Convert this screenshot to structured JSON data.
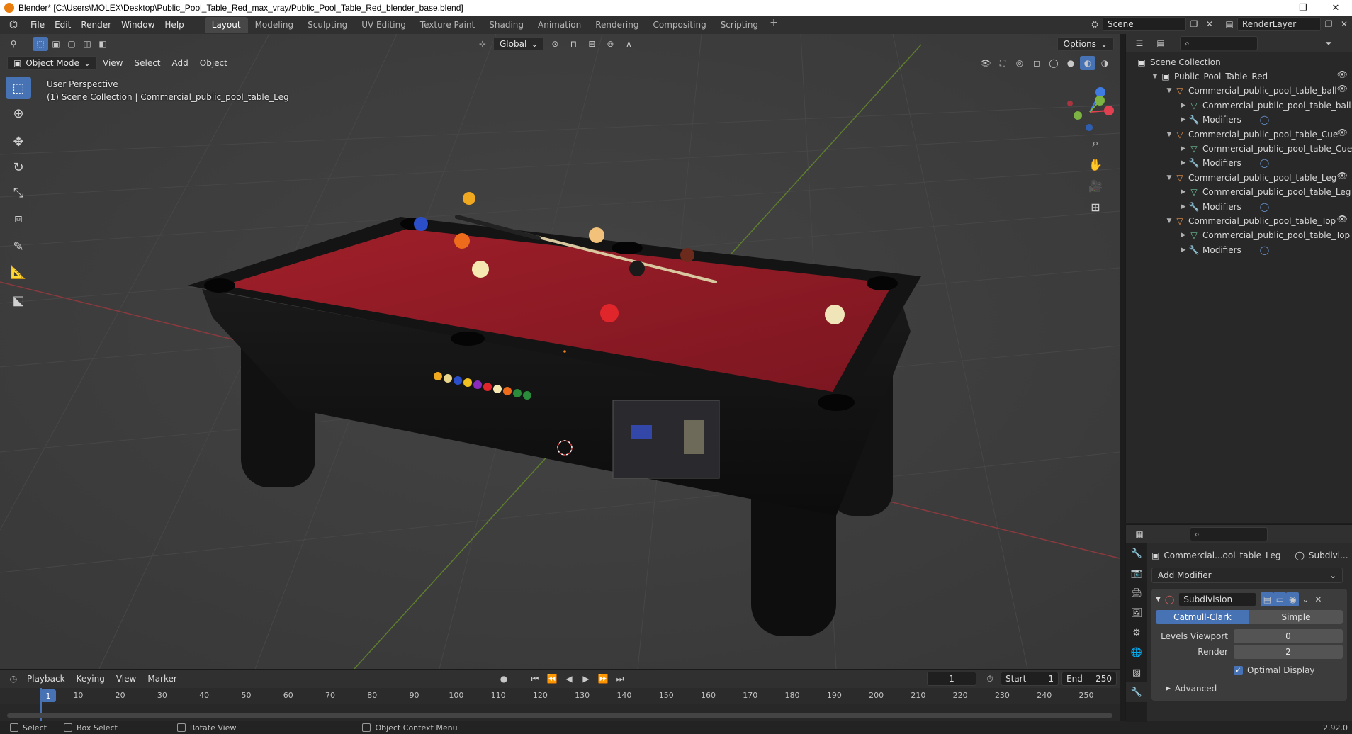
{
  "window": {
    "title": "Blender* [C:\\Users\\MOLEX\\Desktop\\Public_Pool_Table_Red_max_vray/Public_Pool_Table_Red_blender_base.blend]",
    "minimize": "—",
    "maximize": "❐",
    "close": "✕"
  },
  "menu": [
    "File",
    "Edit",
    "Render",
    "Window",
    "Help"
  ],
  "workspaces": [
    "Layout",
    "Modeling",
    "Sculpting",
    "UV Editing",
    "Texture Paint",
    "Shading",
    "Animation",
    "Rendering",
    "Compositing",
    "Scripting"
  ],
  "workspace_add": "+",
  "scene": {
    "name": "Scene",
    "render_layer": "RenderLayer"
  },
  "viewport": {
    "mode": "Object Mode",
    "menus": [
      "View",
      "Select",
      "Add",
      "Object"
    ],
    "transform_orientation": "Global",
    "options_label": "Options",
    "perspective_label": "User Perspective",
    "collection_info": "(1) Scene Collection | Commercial_public_pool_table_Leg",
    "gizmo_axes": {
      "x": "X",
      "y": "Y",
      "z": "Z"
    }
  },
  "tools": [
    "select-box",
    "cursor",
    "move",
    "rotate",
    "scale",
    "transform",
    "annotate",
    "measure",
    "add-cube"
  ],
  "timeline": {
    "menus": [
      "Playback",
      "Keying",
      "View",
      "Marker"
    ],
    "current_frame": "1",
    "start_label": "Start",
    "start": "1",
    "end_label": "End",
    "end": "250",
    "ruler": [
      "10",
      "20",
      "30",
      "40",
      "50",
      "60",
      "70",
      "80",
      "90",
      "100",
      "110",
      "120",
      "130",
      "140",
      "150",
      "160",
      "170",
      "180",
      "190",
      "200",
      "210",
      "220",
      "230",
      "240",
      "250"
    ],
    "ruler_current": "1"
  },
  "statusbar": {
    "items": [
      "Select",
      "Box Select",
      "Rotate View",
      "Object Context Menu"
    ],
    "version": "2.92.0"
  },
  "outliner": {
    "root": "Scene Collection",
    "rows": [
      {
        "label": "Public_Pool_Table_Red",
        "indent": 1,
        "type": "collection",
        "expanded": true
      },
      {
        "label": "Commercial_public_pool_table_ball",
        "indent": 2,
        "type": "object",
        "expanded": true
      },
      {
        "label": "Commercial_public_pool_table_ball",
        "indent": 3,
        "type": "mesh",
        "expanded": false
      },
      {
        "label": "Modifiers",
        "indent": 3,
        "type": "modifier",
        "expanded": false
      },
      {
        "label": "Commercial_public_pool_table_Cue",
        "indent": 2,
        "type": "object",
        "expanded": true
      },
      {
        "label": "Commercial_public_pool_table_Cue",
        "indent": 3,
        "type": "mesh",
        "expanded": false
      },
      {
        "label": "Modifiers",
        "indent": 3,
        "type": "modifier",
        "expanded": false
      },
      {
        "label": "Commercial_public_pool_table_Leg",
        "indent": 2,
        "type": "object",
        "expanded": true
      },
      {
        "label": "Commercial_public_pool_table_Leg",
        "indent": 3,
        "type": "mesh",
        "expanded": false
      },
      {
        "label": "Modifiers",
        "indent": 3,
        "type": "modifier",
        "expanded": false
      },
      {
        "label": "Commercial_public_pool_table_Top",
        "indent": 2,
        "type": "object",
        "expanded": true
      },
      {
        "label": "Commercial_public_pool_table_Top",
        "indent": 3,
        "type": "mesh",
        "expanded": false
      },
      {
        "label": "Modifiers",
        "indent": 3,
        "type": "modifier",
        "expanded": false
      }
    ]
  },
  "properties": {
    "object_name": "Commercial...ool_table_Leg",
    "modifier_short": "Subdivi...",
    "add_modifier": "Add Modifier",
    "modifier": {
      "name": "Subdivision",
      "modes": [
        "Catmull-Clark",
        "Simple"
      ],
      "active_mode": "Catmull-Clark",
      "levels_viewport_label": "Levels Viewport",
      "levels_viewport": "0",
      "render_label": "Render",
      "render": "2",
      "optimal_display_label": "Optimal Display",
      "optimal_display": true,
      "advanced_label": "Advanced"
    }
  },
  "colors": {
    "accent": "#4772b3",
    "felt": "#8e1a24",
    "brand": "#e87d0d",
    "x_axis": "#e04050",
    "y_axis": "#7cb342",
    "z_axis": "#3f7be0"
  }
}
